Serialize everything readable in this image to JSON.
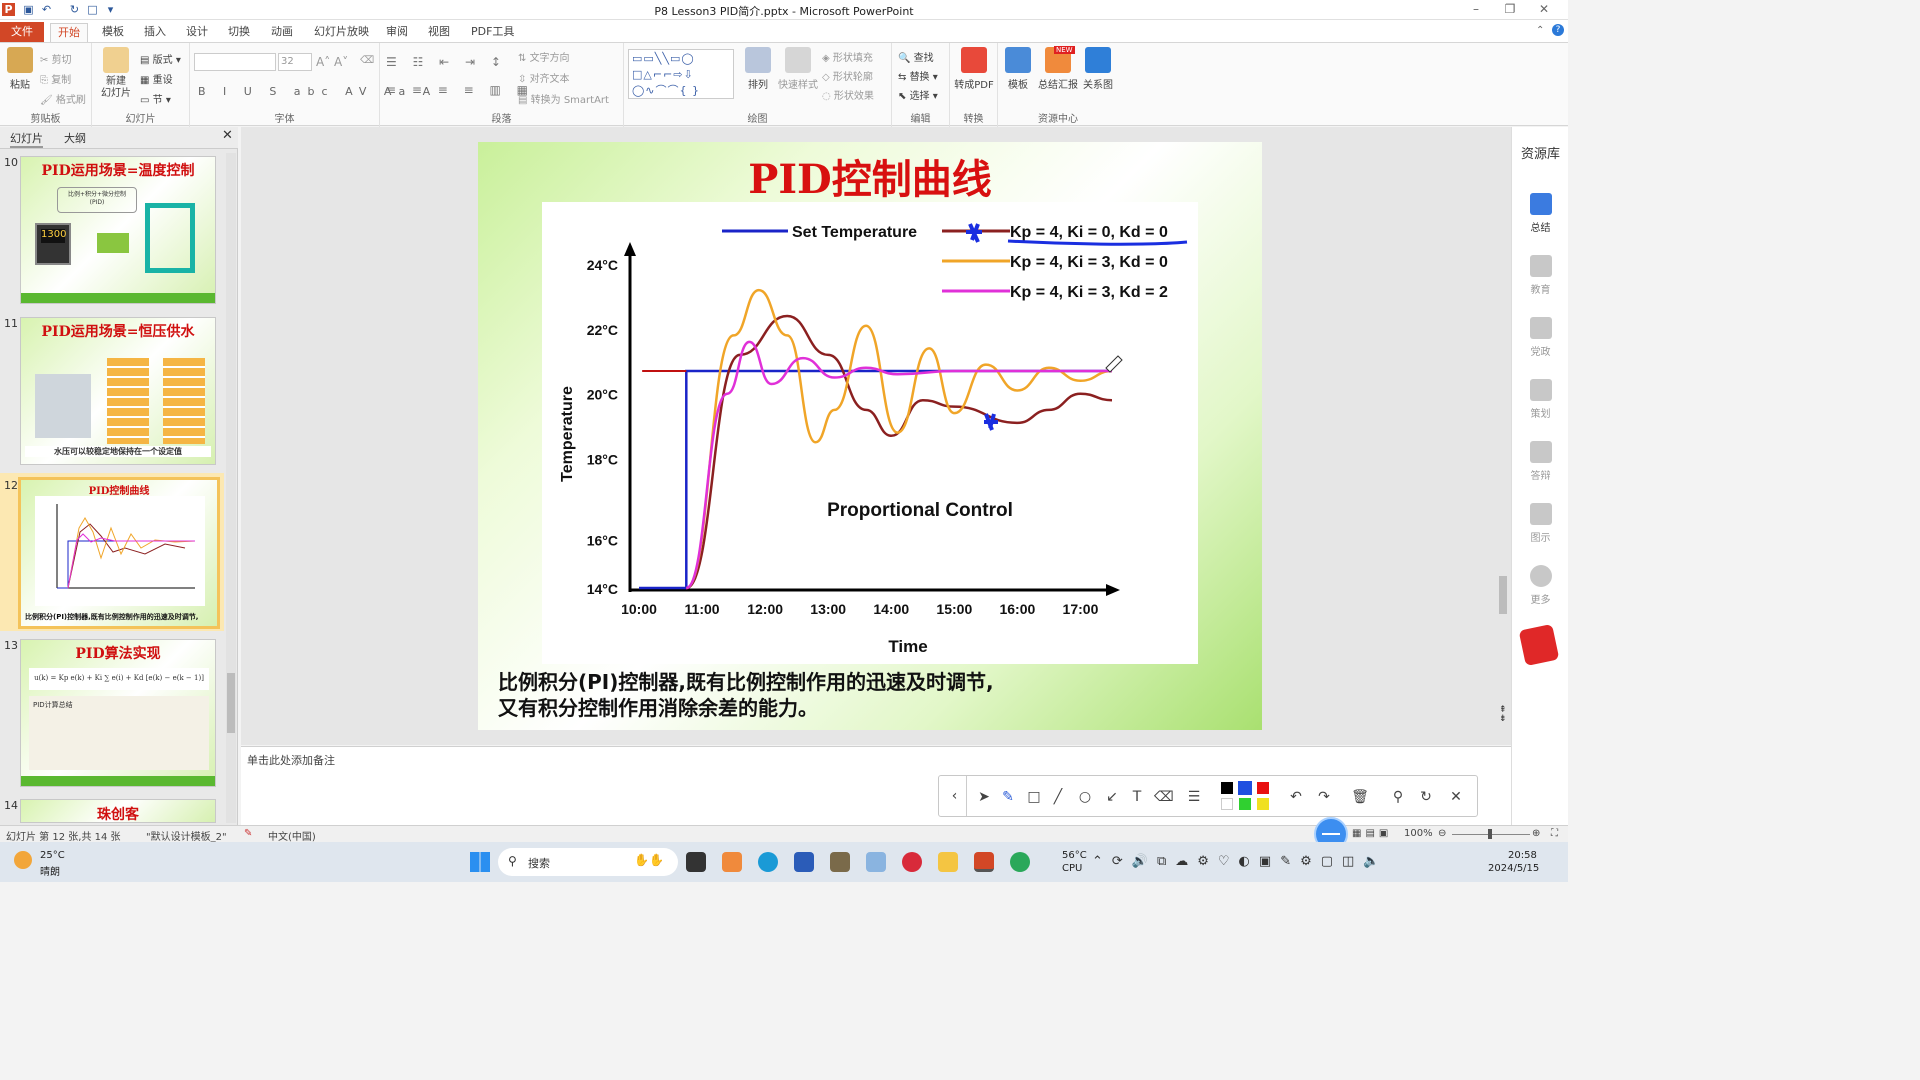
{
  "window": {
    "title": "P8 Lesson3 PID简介.pptx - Microsoft PowerPoint"
  },
  "tabs": [
    "文件",
    "开始",
    "模板",
    "插入",
    "设计",
    "切换",
    "动画",
    "幻灯片放映",
    "审阅",
    "视图",
    "PDF工具"
  ],
  "ribbon": {
    "clipboard": {
      "paste": "粘贴",
      "cut": "剪切",
      "copy": "复制",
      "format_painter": "格式刷",
      "label": "剪贴板"
    },
    "slides": {
      "new_slide": "新建\n幻灯片",
      "layout": "版式",
      "reset": "重设",
      "section": "节",
      "label": "幻灯片"
    },
    "font": {
      "size": "32",
      "label": "字体"
    },
    "paragraph": {
      "text_direction": "文字方向",
      "align_text": "对齐文本",
      "smartart": "转换为 SmartArt",
      "label": "段落"
    },
    "drawing": {
      "arrange": "排列",
      "quick_styles": "快速样式",
      "shape_fill": "形状填充",
      "shape_outline": "形状轮廓",
      "shape_effects": "形状效果",
      "label": "绘图"
    },
    "editing": {
      "find": "查找",
      "replace": "替换",
      "select": "选择",
      "label": "编辑"
    },
    "convert": {
      "to_pdf": "转成PDF",
      "label": "转换"
    },
    "resources": {
      "template": "模板",
      "summary": "总结汇报",
      "relation": "关系图",
      "new_badge": "NEW",
      "label": "资源中心"
    }
  },
  "left_panel": {
    "tab_slides": "幻灯片",
    "tab_outline": "大纲",
    "thumbs": [
      {
        "num": "10",
        "title": "PID运用场景=温度控制",
        "note1": "比例+积分+微分控制",
        "note2": "(PID)"
      },
      {
        "num": "11",
        "title": "PID运用场景=恒压供水",
        "note1": "水压可以较稳定地保持在一个设定值"
      },
      {
        "num": "12",
        "title": "PID控制曲线",
        "note1": "比例积分(PI)控制器,既有比例控制作用的迅速及时调节,"
      },
      {
        "num": "13",
        "title": "PID算法实现",
        "note1": "u(k) = Kp e(k) + Ki ∑ e(i) + Kd [e(k) − e(k − 1)]",
        "note2": "PID计算总结"
      },
      {
        "num": "14",
        "title": "珠创客"
      }
    ]
  },
  "slide": {
    "title": "PID控制曲线",
    "caption_line1": "比例积分(PI)控制器,既有比例控制作用的迅速及时调节,",
    "caption_line2": "又有积分控制作用消除余差的能力。"
  },
  "chart_data": {
    "type": "line",
    "title": "",
    "annotation": "Proportional Control",
    "xlabel": "Time",
    "ylabel": "Temperature",
    "x_ticks": [
      "10:00",
      "11:00",
      "12:00",
      "13:00",
      "14:00",
      "15:00",
      "16:00",
      "17:00"
    ],
    "y_ticks": [
      "24°C",
      "22°C",
      "20°C",
      "18°C",
      "16°C",
      "14°C"
    ],
    "ylim": [
      14,
      24.5
    ],
    "legend_position": "top-right",
    "series": [
      {
        "name": "Set Temperature",
        "color": "#1a24c8",
        "points": [
          [
            10.0,
            14
          ],
          [
            10.75,
            14
          ],
          [
            10.75,
            20.7
          ],
          [
            17.5,
            20.7
          ]
        ]
      },
      {
        "name": "Kp = 4, Ki = 0, Kd = 0",
        "color": "#8b2020",
        "points": [
          [
            10.75,
            14
          ],
          [
            11.6,
            21.2
          ],
          [
            12.35,
            22.4
          ],
          [
            13.0,
            21.2
          ],
          [
            13.6,
            19.5
          ],
          [
            14.0,
            18.7
          ],
          [
            14.5,
            19.8
          ],
          [
            15.0,
            19.6
          ],
          [
            16.0,
            19.1
          ],
          [
            16.5,
            19.5
          ],
          [
            17.0,
            20.0
          ],
          [
            17.5,
            19.8
          ]
        ]
      },
      {
        "name": "Kp = 4, Ki = 3, Kd = 0",
        "color": "#f0a528",
        "points": [
          [
            10.75,
            14
          ],
          [
            11.5,
            21.8
          ],
          [
            11.9,
            23.2
          ],
          [
            12.35,
            21.8
          ],
          [
            12.8,
            18.5
          ],
          [
            13.1,
            19.5
          ],
          [
            13.6,
            22.1
          ],
          [
            14.1,
            18.8
          ],
          [
            14.6,
            21.4
          ],
          [
            15.0,
            19.4
          ],
          [
            15.5,
            20.9
          ],
          [
            16.0,
            20.1
          ],
          [
            16.5,
            20.8
          ],
          [
            17.0,
            20.4
          ],
          [
            17.5,
            20.7
          ]
        ]
      },
      {
        "name": "Kp = 4, Ki = 3, Kd = 2",
        "color": "#e030d8",
        "points": [
          [
            10.75,
            14
          ],
          [
            11.4,
            20.0
          ],
          [
            11.75,
            21.6
          ],
          [
            12.1,
            20.3
          ],
          [
            12.6,
            21.1
          ],
          [
            13.1,
            20.5
          ],
          [
            13.6,
            20.8
          ],
          [
            14.1,
            20.6
          ],
          [
            15.0,
            20.7
          ],
          [
            17.5,
            20.7
          ]
        ]
      }
    ]
  },
  "pen_toolbar": {
    "colors": [
      "#000000",
      "#1f4fe0",
      "#e81010",
      "#ffffff",
      "#30d030",
      "#f0e020"
    ]
  },
  "notes": {
    "placeholder": "单击此处添加备注"
  },
  "right_sidebar": {
    "title": "资源库",
    "items": [
      "总结",
      "教育",
      "党政",
      "策划",
      "答辩",
      "图示",
      "更多"
    ]
  },
  "status": {
    "slide_info": "幻灯片 第 12 张,共 14 张",
    "theme": "\"默认设计模板_2\"",
    "lang": "中文(中国)",
    "zoom": "100%"
  },
  "taskbar": {
    "weather_temp": "25°C",
    "weather_desc": "晴朗",
    "search": "搜索",
    "cpu_temp": "56°C",
    "cpu_label": "CPU",
    "time": "20:58",
    "date": "2024/5/15"
  }
}
